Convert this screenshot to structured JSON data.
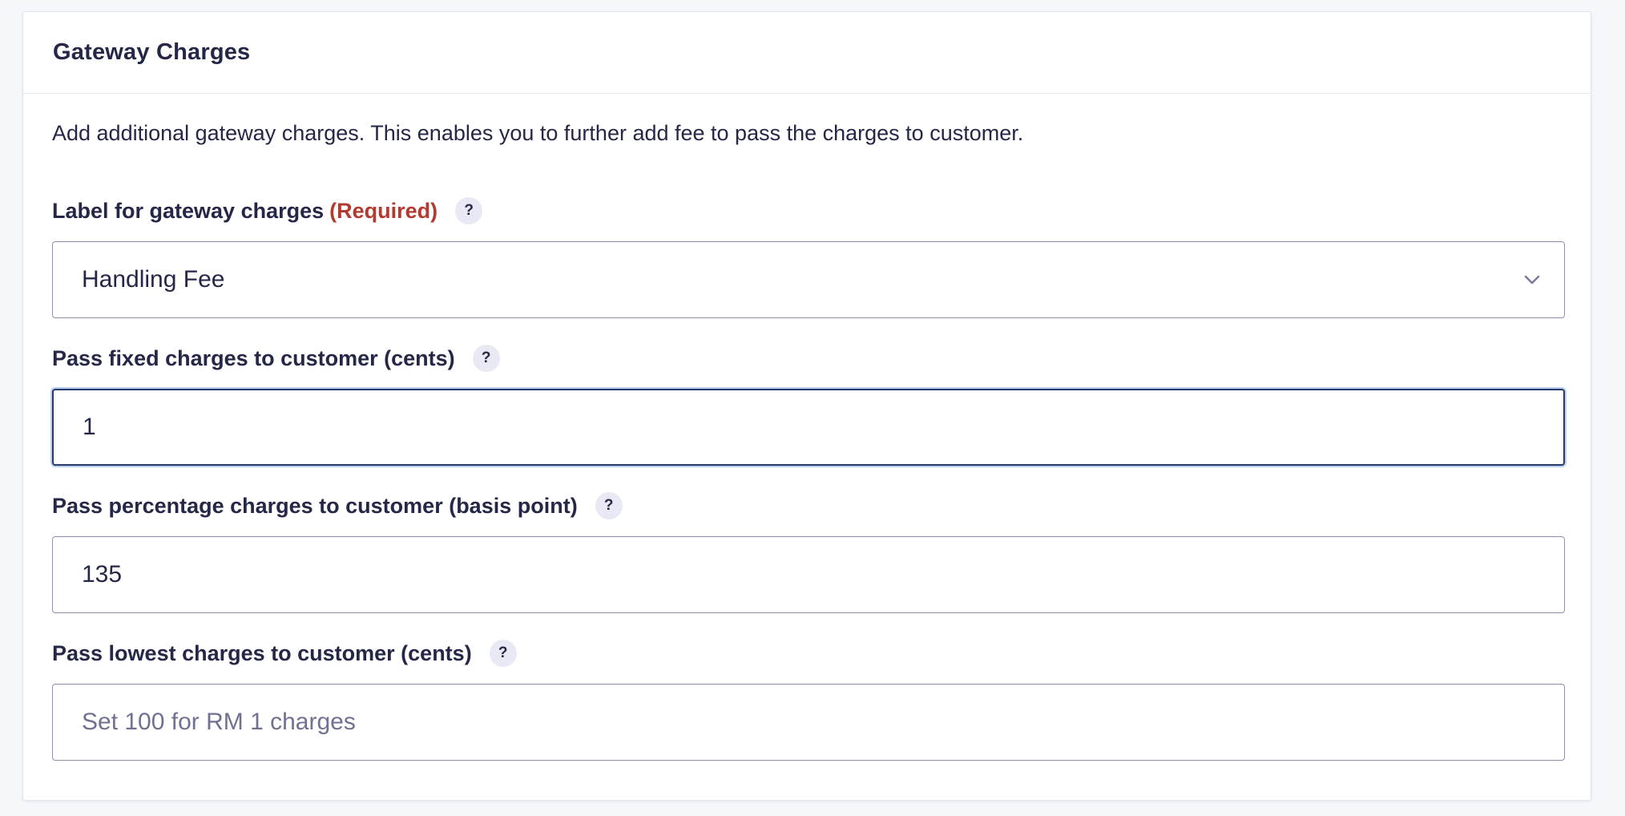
{
  "panel": {
    "title": "Gateway Charges",
    "description": "Add additional gateway charges. This enables you to further add fee to pass the charges to customer."
  },
  "fields": {
    "label_charges": {
      "label": "Label for gateway charges",
      "required_text": "(Required)",
      "help": "?",
      "selected_value": "Handling Fee"
    },
    "fixed_charges": {
      "label": "Pass fixed charges to customer (cents)",
      "help": "?",
      "value": "1"
    },
    "percentage_charges": {
      "label": "Pass percentage charges to customer (basis point)",
      "help": "?",
      "value": "135"
    },
    "lowest_charges": {
      "label": "Pass lowest charges to customer (cents)",
      "help": "?",
      "value": "",
      "placeholder": "Set 100 for RM 1 charges"
    }
  },
  "icons": {
    "help": "help-question-icon",
    "dropdown": "chevron-down-icon"
  },
  "colors": {
    "required": "#b23a2f",
    "text": "#242748",
    "focus_ring": "#b9d0ef"
  }
}
